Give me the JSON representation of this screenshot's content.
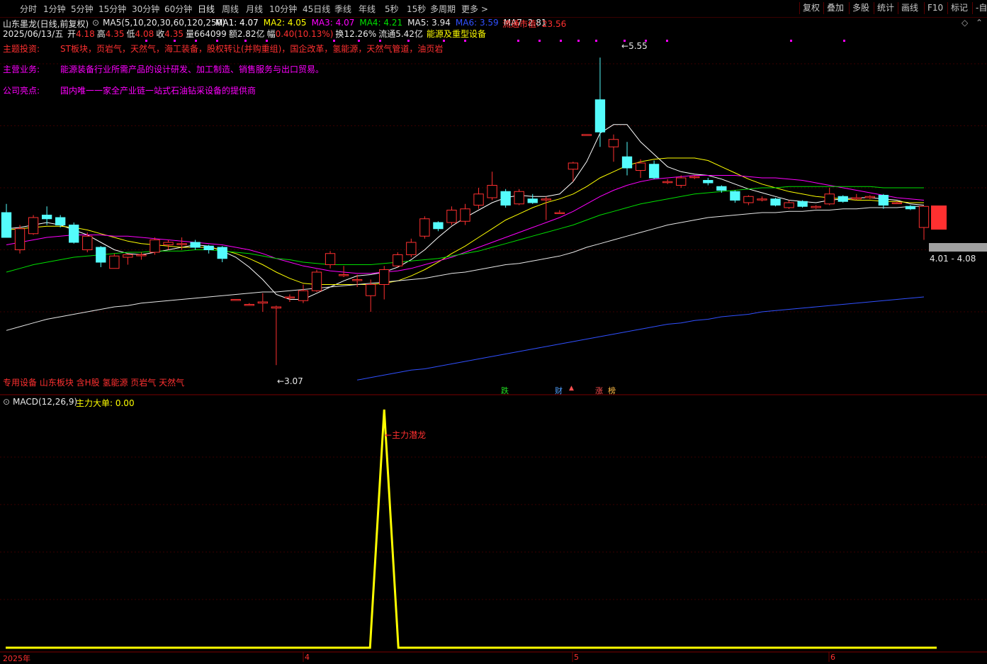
{
  "toolbar": {
    "items": [
      "分时",
      "1分钟",
      "5分钟",
      "15分钟",
      "30分钟",
      "60分钟",
      "日线",
      "周线",
      "月线",
      "10分钟",
      "45日线",
      "季线",
      "年线",
      "5秒",
      "15秒",
      "多周期",
      "更多 >"
    ],
    "active": "日线",
    "right_items": [
      "复权",
      "叠加",
      "多股",
      "统计",
      "画线",
      "F10",
      "标记",
      "-自"
    ]
  },
  "header": {
    "stock_name": "山东墨龙(日线,前复权)",
    "ma_params": "MA5(5,10,20,30,60,120,250)",
    "ma": [
      {
        "label": "MA1: 4.07",
        "color": "#ffffff"
      },
      {
        "label": "MA2: 4.05",
        "color": "#ffff00"
      },
      {
        "label": "MA3: 4.07",
        "color": "#ff00ff"
      },
      {
        "label": "MA4: 4.21",
        "color": "#00e000"
      },
      {
        "label": "MA5: 3.94",
        "color": "#e8e8e8"
      },
      {
        "label": "MA6: 3.59",
        "color": "#3050ff"
      },
      {
        "label": "MA7: 2.81",
        "color": "#e8e8e8"
      }
    ],
    "market_cap_label": "流通市值: 23.56",
    "date": "2025/06/13/五",
    "quote": [
      {
        "k": "开",
        "v": "4.18"
      },
      {
        "k": "高",
        "v": "4.35"
      },
      {
        "k": "低",
        "v": "4.08"
      },
      {
        "k": "收",
        "v": "4.35"
      },
      {
        "k": "量",
        "v": "664099"
      },
      {
        "k": "额",
        "v": "2.82亿"
      },
      {
        "k": "幅",
        "v": "0.40(10.13%)"
      },
      {
        "k": "换",
        "v": "12.26%"
      },
      {
        "k": "流通",
        "v": "5.42亿"
      }
    ],
    "industry": "能源及重型设备"
  },
  "info": {
    "theme_label": "主题投资:",
    "theme_value": "ST板块，页岩气，天然气，海工装备，股权转让(并购重组)，国企改革，氢能源，天然气管道，油页岩",
    "business_label": "主营业务:",
    "business_value": "能源装备行业所需产品的设计研发、加工制造、销售服务与出口贸易。",
    "highlight_label": "公司亮点:",
    "highlight_value": "国内唯一一家全产业链一站式石油钻采设备的提供商"
  },
  "concept_tags": "专用设备 山东板块 含H股 氢能源 页岩气 天然气",
  "markers": {
    "die": "跌",
    "cai": "财",
    "zhang": "涨",
    "bang": "榜"
  },
  "price_labels": {
    "high": "5.55",
    "low": "3.07",
    "range": "4.01 - 4.08"
  },
  "indicator": {
    "title": "MACD(12,26,9)",
    "main_force": "主力大单: 0.00",
    "signal_label": "主力潜龙"
  },
  "x_axis": [
    "2025年",
    "4",
    "5",
    "6"
  ],
  "colors": {
    "up": "#ff3030",
    "down": "#54fcfc",
    "ma1": "#ffffff",
    "ma2": "#ffff00",
    "ma3": "#ff00ff",
    "ma4": "#00e000",
    "ma6": "#3050ff",
    "signal": "#ffff00"
  },
  "chart_data": {
    "type": "candlestick",
    "price_range": [
      2.9,
      5.7
    ],
    "candles": [
      {
        "o": 4.3,
        "c": 4.1,
        "h": 4.37,
        "l": 4.1
      },
      {
        "o": 4.0,
        "c": 4.17,
        "h": 4.2,
        "l": 3.97
      },
      {
        "o": 4.13,
        "c": 4.26,
        "h": 4.28,
        "l": 4.12
      },
      {
        "o": 4.28,
        "c": 4.25,
        "h": 4.35,
        "l": 4.2
      },
      {
        "o": 4.26,
        "c": 4.2,
        "h": 4.28,
        "l": 4.18
      },
      {
        "o": 4.2,
        "c": 4.06,
        "h": 4.22,
        "l": 4.05
      },
      {
        "o": 4.0,
        "c": 4.11,
        "h": 4.14,
        "l": 3.98
      },
      {
        "o": 4.02,
        "c": 3.9,
        "h": 4.03,
        "l": 3.86
      },
      {
        "o": 3.85,
        "c": 3.95,
        "h": 3.97,
        "l": 3.85
      },
      {
        "o": 3.94,
        "c": 3.96,
        "h": 3.97,
        "l": 3.88
      },
      {
        "o": 3.96,
        "c": 3.96,
        "h": 3.98,
        "l": 3.92
      },
      {
        "o": 3.98,
        "c": 4.08,
        "h": 4.1,
        "l": 3.96
      },
      {
        "o": 4.04,
        "c": 4.06,
        "h": 4.08,
        "l": 4.0
      },
      {
        "o": 4.05,
        "c": 4.05,
        "h": 4.1,
        "l": 4.0
      },
      {
        "o": 4.06,
        "c": 4.02,
        "h": 4.08,
        "l": 4.0
      },
      {
        "o": 4.03,
        "c": 4.0,
        "h": 4.04,
        "l": 3.97
      },
      {
        "o": 4.02,
        "c": 3.93,
        "h": 4.03,
        "l": 3.9
      },
      {
        "o": 3.6,
        "c": 3.6,
        "h": 3.6,
        "l": 3.6
      },
      {
        "o": 3.56,
        "c": 3.56,
        "h": 3.57,
        "l": 3.55
      },
      {
        "o": 3.57,
        "c": 3.58,
        "h": 3.65,
        "l": 3.5
      },
      {
        "o": 3.53,
        "c": 3.54,
        "h": 3.55,
        "l": 3.07
      },
      {
        "o": 3.62,
        "c": 3.62,
        "h": 3.64,
        "l": 3.58
      },
      {
        "o": 3.59,
        "c": 3.67,
        "h": 3.72,
        "l": 3.57
      },
      {
        "o": 3.67,
        "c": 3.82,
        "h": 3.84,
        "l": 3.66
      },
      {
        "o": 3.88,
        "c": 3.97,
        "h": 3.99,
        "l": 3.85
      },
      {
        "o": 3.8,
        "c": 3.8,
        "h": 3.87,
        "l": 3.78
      },
      {
        "o": 3.76,
        "c": 3.76,
        "h": 3.8,
        "l": 3.7
      },
      {
        "o": 3.63,
        "c": 3.72,
        "h": 3.76,
        "l": 3.5
      },
      {
        "o": 3.72,
        "c": 3.84,
        "h": 3.87,
        "l": 3.6
      },
      {
        "o": 3.87,
        "c": 3.96,
        "h": 3.98,
        "l": 3.86
      },
      {
        "o": 3.96,
        "c": 4.06,
        "h": 4.09,
        "l": 3.94
      },
      {
        "o": 4.11,
        "c": 4.25,
        "h": 4.27,
        "l": 4.09
      },
      {
        "o": 4.22,
        "c": 4.17,
        "h": 4.23,
        "l": 4.15
      },
      {
        "o": 4.22,
        "c": 4.32,
        "h": 4.35,
        "l": 4.2
      },
      {
        "o": 4.23,
        "c": 4.33,
        "h": 4.37,
        "l": 4.2
      },
      {
        "o": 4.36,
        "c": 4.45,
        "h": 4.5,
        "l": 4.33
      },
      {
        "o": 4.42,
        "c": 4.52,
        "h": 4.63,
        "l": 4.4
      },
      {
        "o": 4.47,
        "c": 4.36,
        "h": 4.49,
        "l": 4.34
      },
      {
        "o": 4.37,
        "c": 4.47,
        "h": 4.49,
        "l": 4.36
      },
      {
        "o": 4.41,
        "c": 4.38,
        "h": 4.45,
        "l": 4.37
      },
      {
        "o": 4.41,
        "c": 4.41,
        "h": 4.43,
        "l": 4.24
      },
      {
        "o": 4.3,
        "c": 4.3,
        "h": 4.32,
        "l": 4.3
      },
      {
        "o": 4.65,
        "c": 4.7,
        "h": 4.71,
        "l": 4.55
      },
      {
        "o": 4.93,
        "c": 4.93,
        "h": 4.93,
        "l": 4.93
      },
      {
        "o": 5.21,
        "c": 4.95,
        "h": 5.55,
        "l": 4.83
      },
      {
        "o": 4.83,
        "c": 4.89,
        "h": 4.93,
        "l": 4.71
      },
      {
        "o": 4.75,
        "c": 4.66,
        "h": 4.87,
        "l": 4.6
      },
      {
        "o": 4.64,
        "c": 4.7,
        "h": 4.73,
        "l": 4.58
      },
      {
        "o": 4.69,
        "c": 4.58,
        "h": 4.72,
        "l": 4.57
      },
      {
        "o": 4.55,
        "c": 4.55,
        "h": 4.57,
        "l": 4.53
      },
      {
        "o": 4.52,
        "c": 4.58,
        "h": 4.6,
        "l": 4.5
      },
      {
        "o": 4.59,
        "c": 4.59,
        "h": 4.6,
        "l": 4.57
      },
      {
        "o": 4.56,
        "c": 4.54,
        "h": 4.58,
        "l": 4.52
      },
      {
        "o": 4.51,
        "c": 4.48,
        "h": 4.52,
        "l": 4.46
      },
      {
        "o": 4.47,
        "c": 4.4,
        "h": 4.48,
        "l": 4.38
      },
      {
        "o": 4.38,
        "c": 4.43,
        "h": 4.44,
        "l": 4.36
      },
      {
        "o": 4.41,
        "c": 4.41,
        "h": 4.43,
        "l": 4.39
      },
      {
        "o": 4.41,
        "c": 4.36,
        "h": 4.42,
        "l": 4.35
      },
      {
        "o": 4.34,
        "c": 4.38,
        "h": 4.4,
        "l": 4.33
      },
      {
        "o": 4.39,
        "c": 4.35,
        "h": 4.4,
        "l": 4.34
      },
      {
        "o": 4.34,
        "c": 4.35,
        "h": 4.36,
        "l": 4.33
      },
      {
        "o": 4.37,
        "c": 4.45,
        "h": 4.5,
        "l": 4.36
      },
      {
        "o": 4.43,
        "c": 4.39,
        "h": 4.44,
        "l": 4.38
      },
      {
        "o": 4.41,
        "c": 4.42,
        "h": 4.45,
        "l": 4.4
      },
      {
        "o": 4.42,
        "c": 4.43,
        "h": 4.44,
        "l": 4.41
      },
      {
        "o": 4.44,
        "c": 4.36,
        "h": 4.45,
        "l": 4.33
      },
      {
        "o": 4.38,
        "c": 4.38,
        "h": 4.39,
        "l": 4.37
      },
      {
        "o": 4.35,
        "c": 4.33,
        "h": 4.36,
        "l": 4.32
      },
      {
        "o": 4.18,
        "c": 4.35,
        "h": 4.35,
        "l": 4.08
      }
    ],
    "ma_lines": [
      {
        "name": "MA1",
        "color": "#ffffff",
        "values": [
          4.17,
          4.18,
          4.2,
          4.22,
          4.2,
          4.16,
          4.12,
          4.06,
          4.0,
          3.97,
          3.96,
          3.98,
          4.0,
          4.02,
          4.04,
          4.03,
          3.99,
          3.94,
          3.86,
          3.76,
          3.64,
          3.6,
          3.6,
          3.65,
          3.7,
          3.75,
          3.79,
          3.8,
          3.82,
          3.86,
          3.92,
          4.0,
          4.1,
          4.19,
          4.26,
          4.32,
          4.38,
          4.42,
          4.44,
          4.43,
          4.43,
          4.45,
          4.55,
          4.71,
          4.94,
          5.01,
          5.01,
          4.87,
          4.77,
          4.67,
          4.63,
          4.61,
          4.6,
          4.57,
          4.53,
          4.49,
          4.46,
          4.43,
          4.4,
          4.39,
          4.38,
          4.4,
          4.41,
          4.42,
          4.42,
          4.41,
          4.4,
          4.37,
          4.36
        ]
      },
      {
        "name": "MA2",
        "color": "#ffff00",
        "values": [
          4.16,
          4.17,
          4.18,
          4.19,
          4.19,
          4.18,
          4.16,
          4.13,
          4.1,
          4.07,
          4.05,
          4.04,
          4.03,
          4.02,
          4.02,
          4.02,
          4.0,
          3.97,
          3.93,
          3.88,
          3.82,
          3.77,
          3.73,
          3.72,
          3.72,
          3.72,
          3.72,
          3.72,
          3.73,
          3.75,
          3.79,
          3.84,
          3.9,
          3.97,
          4.03,
          4.1,
          4.17,
          4.24,
          4.29,
          4.34,
          4.38,
          4.41,
          4.45,
          4.51,
          4.58,
          4.63,
          4.68,
          4.71,
          4.73,
          4.74,
          4.74,
          4.74,
          4.72,
          4.67,
          4.62,
          4.57,
          4.53,
          4.5,
          4.47,
          4.45,
          4.43,
          4.42,
          4.41,
          4.4,
          4.4,
          4.39,
          4.39,
          4.38,
          4.38
        ]
      },
      {
        "name": "MA3",
        "color": "#ff00ff",
        "values": [
          4.04,
          4.06,
          4.08,
          4.1,
          4.11,
          4.12,
          4.12,
          4.12,
          4.11,
          4.11,
          4.1,
          4.09,
          4.08,
          4.07,
          4.06,
          4.05,
          4.04,
          4.02,
          4.0,
          3.97,
          3.93,
          3.9,
          3.87,
          3.85,
          3.83,
          3.82,
          3.81,
          3.81,
          3.82,
          3.83,
          3.85,
          3.88,
          3.91,
          3.94,
          3.98,
          4.02,
          4.06,
          4.1,
          4.14,
          4.18,
          4.22,
          4.26,
          4.31,
          4.37,
          4.43,
          4.48,
          4.52,
          4.55,
          4.57,
          4.58,
          4.59,
          4.6,
          4.6,
          4.6,
          4.6,
          4.59,
          4.58,
          4.58,
          4.57,
          4.56,
          4.54,
          4.52,
          4.5,
          4.48,
          4.46,
          4.44,
          4.42,
          4.41,
          4.4
        ]
      },
      {
        "name": "MA4",
        "color": "#00e000",
        "values": [
          3.82,
          3.85,
          3.88,
          3.9,
          3.92,
          3.94,
          3.95,
          3.96,
          3.97,
          3.98,
          3.98,
          3.99,
          3.99,
          3.99,
          4.0,
          4.0,
          3.99,
          3.98,
          3.97,
          3.95,
          3.93,
          3.92,
          3.9,
          3.89,
          3.88,
          3.88,
          3.88,
          3.88,
          3.89,
          3.9,
          3.91,
          3.92,
          3.93,
          3.95,
          3.97,
          3.99,
          4.02,
          4.05,
          4.08,
          4.11,
          4.14,
          4.17,
          4.2,
          4.24,
          4.28,
          4.31,
          4.34,
          4.37,
          4.39,
          4.41,
          4.43,
          4.45,
          4.46,
          4.47,
          4.48,
          4.49,
          4.5,
          4.5,
          4.51,
          4.51,
          4.51,
          4.51,
          4.51,
          4.51,
          4.51,
          4.5,
          4.5,
          4.5,
          4.5
        ]
      },
      {
        "name": "MA5",
        "color": "#e8e8e8",
        "values": [
          3.35,
          3.38,
          3.41,
          3.44,
          3.46,
          3.48,
          3.5,
          3.52,
          3.54,
          3.55,
          3.57,
          3.58,
          3.59,
          3.6,
          3.61,
          3.62,
          3.63,
          3.64,
          3.65,
          3.66,
          3.66,
          3.67,
          3.68,
          3.69,
          3.7,
          3.71,
          3.72,
          3.73,
          3.74,
          3.75,
          3.76,
          3.77,
          3.79,
          3.81,
          3.82,
          3.84,
          3.86,
          3.88,
          3.89,
          3.91,
          3.93,
          3.95,
          3.98,
          4.02,
          4.05,
          4.08,
          4.11,
          4.14,
          4.17,
          4.2,
          4.22,
          4.24,
          4.26,
          4.27,
          4.28,
          4.29,
          4.3,
          4.3,
          4.31,
          4.31,
          4.32,
          4.32,
          4.33,
          4.33,
          4.34,
          4.34,
          4.34,
          4.35,
          4.35
        ]
      },
      {
        "name": "MA6",
        "color": "#3050ff",
        "values": [
          null,
          null,
          null,
          null,
          null,
          null,
          null,
          null,
          null,
          null,
          null,
          null,
          null,
          null,
          null,
          null,
          null,
          null,
          null,
          null,
          null,
          null,
          null,
          null,
          null,
          null,
          2.95,
          2.97,
          2.99,
          3.01,
          3.03,
          3.04,
          3.06,
          3.08,
          3.1,
          3.12,
          3.14,
          3.16,
          3.18,
          3.2,
          3.22,
          3.24,
          3.26,
          3.28,
          3.3,
          3.32,
          3.34,
          3.36,
          3.38,
          3.4,
          3.41,
          3.43,
          3.44,
          3.46,
          3.47,
          3.48,
          3.5,
          3.51,
          3.52,
          3.53,
          3.54,
          3.55,
          3.56,
          3.57,
          3.58,
          3.59,
          3.6,
          3.61,
          3.62
        ]
      }
    ],
    "indicator_spike_index": 28,
    "indicator_values": {
      "baseline": 0,
      "peak": 1
    }
  }
}
